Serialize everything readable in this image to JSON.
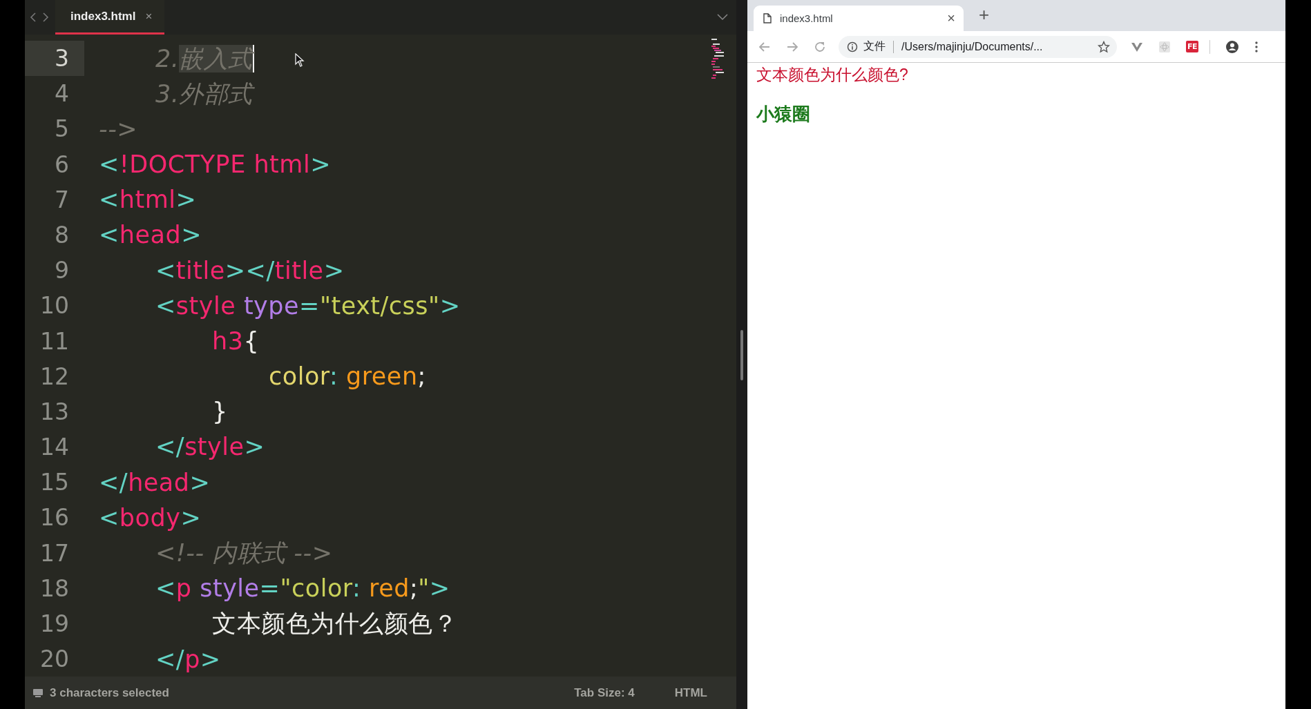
{
  "editor": {
    "nav": [
      {
        "kind": "back"
      },
      {
        "kind": "forward"
      }
    ],
    "tab": {
      "title": "index3.html",
      "close": "×",
      "selected": true
    },
    "lines": [
      {
        "number": "3",
        "current": true,
        "tokens": [
          {
            "kind": "comment",
            "text": "    2.",
            "selected": false
          },
          {
            "kind": "comment",
            "text": "嵌入式",
            "selected": true,
            "caret": true
          }
        ]
      },
      {
        "number": "4",
        "current": false,
        "tokens": [
          {
            "kind": "comment",
            "text": "    3.外部式"
          }
        ]
      },
      {
        "number": "5",
        "current": false,
        "tokens": [
          {
            "kind": "comment",
            "text": "-->"
          }
        ]
      },
      {
        "number": "6",
        "current": false,
        "tokens": [
          {
            "kind": "punct",
            "text": "<"
          },
          {
            "kind": "tag",
            "text": "!DOCTYPE html"
          },
          {
            "kind": "punct",
            "text": ">"
          }
        ]
      },
      {
        "number": "7",
        "current": false,
        "tokens": [
          {
            "kind": "punct",
            "text": "<"
          },
          {
            "kind": "tag",
            "text": "html"
          },
          {
            "kind": "punct",
            "text": ">"
          }
        ]
      },
      {
        "number": "8",
        "current": false,
        "tokens": [
          {
            "kind": "punct",
            "text": "<"
          },
          {
            "kind": "tag",
            "text": "head"
          },
          {
            "kind": "punct",
            "text": ">"
          }
        ]
      },
      {
        "number": "9",
        "current": false,
        "tokens": [
          {
            "kind": "punct",
            "text": "    <"
          },
          {
            "kind": "tag",
            "text": "title"
          },
          {
            "kind": "punct",
            "text": "></"
          },
          {
            "kind": "tag",
            "text": "title"
          },
          {
            "kind": "punct",
            "text": ">"
          }
        ]
      },
      {
        "number": "10",
        "current": false,
        "tokens": [
          {
            "kind": "punct",
            "text": "    <"
          },
          {
            "kind": "tag",
            "text": "style"
          },
          {
            "kind": "attr",
            "text": " type"
          },
          {
            "kind": "punct",
            "text": "="
          },
          {
            "kind": "str",
            "text": "\"text/css\""
          },
          {
            "kind": "punct",
            "text": ">"
          }
        ]
      },
      {
        "number": "11",
        "current": false,
        "tokens": [
          {
            "kind": "tag",
            "text": "        h3"
          },
          {
            "kind": "plain",
            "text": "{"
          }
        ]
      },
      {
        "number": "12",
        "current": false,
        "tokens": [
          {
            "kind": "prop",
            "text": "            color"
          },
          {
            "kind": "punct",
            "text": ":"
          },
          {
            "kind": "val",
            "text": " green"
          },
          {
            "kind": "plain",
            "text": ";"
          }
        ]
      },
      {
        "number": "13",
        "current": false,
        "tokens": [
          {
            "kind": "plain",
            "text": "        }"
          }
        ]
      },
      {
        "number": "14",
        "current": false,
        "tokens": [
          {
            "kind": "punct",
            "text": "    </"
          },
          {
            "kind": "tag",
            "text": "style"
          },
          {
            "kind": "punct",
            "text": ">"
          }
        ]
      },
      {
        "number": "15",
        "current": false,
        "tokens": [
          {
            "kind": "punct",
            "text": "</"
          },
          {
            "kind": "tag",
            "text": "head"
          },
          {
            "kind": "punct",
            "text": ">"
          }
        ]
      },
      {
        "number": "16",
        "current": false,
        "tokens": [
          {
            "kind": "punct",
            "text": "<"
          },
          {
            "kind": "tag",
            "text": "body"
          },
          {
            "kind": "punct",
            "text": ">"
          }
        ]
      },
      {
        "number": "17",
        "current": false,
        "tokens": [
          {
            "kind": "comment",
            "text": "    <!-- 内联式 -->"
          }
        ]
      },
      {
        "number": "18",
        "current": false,
        "tokens": [
          {
            "kind": "punct",
            "text": "    <"
          },
          {
            "kind": "tag",
            "text": "p"
          },
          {
            "kind": "attr",
            "text": " style"
          },
          {
            "kind": "punct",
            "text": "="
          },
          {
            "kind": "str",
            "text": "\"color"
          },
          {
            "kind": "punct",
            "text": ":"
          },
          {
            "kind": "val",
            "text": " red"
          },
          {
            "kind": "plain",
            "text": ";"
          },
          {
            "kind": "str",
            "text": "\""
          },
          {
            "kind": "punct",
            "text": ">"
          }
        ]
      },
      {
        "number": "19",
        "current": false,
        "tokens": [
          {
            "kind": "plain",
            "text": "        文本颜色为什么颜色？"
          }
        ]
      },
      {
        "number": "20",
        "current": false,
        "tokens": [
          {
            "kind": "punct",
            "text": "    </"
          },
          {
            "kind": "tag",
            "text": "p"
          },
          {
            "kind": "punct",
            "text": ">"
          }
        ]
      }
    ],
    "status": {
      "selection": "3 characters selected",
      "tab_size": "Tab Size: 4",
      "syntax": "HTML"
    }
  },
  "browser": {
    "tab": {
      "title": "index3.html",
      "close": "×",
      "selected": true
    },
    "new_tab": "+",
    "address": {
      "scheme": "文件",
      "url": "/Users/majinju/Documents/..."
    },
    "extensions": [
      {
        "kind": "vue"
      },
      {
        "kind": "react"
      },
      {
        "kind": "badge",
        "label": "FE"
      }
    ],
    "content": [
      {
        "kind": "paragraph",
        "text": "文本颜色为什么颜色?",
        "color": "#c8102e"
      },
      {
        "kind": "heading",
        "text": "小猿圈",
        "color": "#1c7a1c"
      }
    ]
  }
}
